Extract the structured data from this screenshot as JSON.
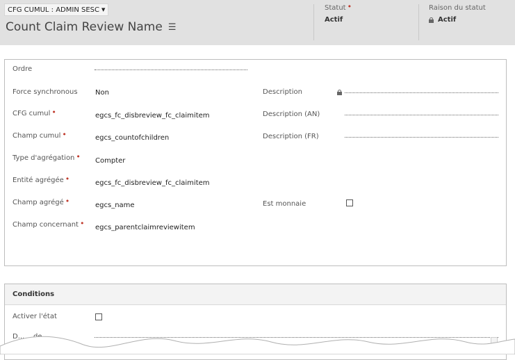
{
  "header": {
    "entity_name": "CFG CUMUL : ADMIN SESC",
    "record_title": "Count Claim Review Name",
    "status_label": "Statut",
    "status_value": "Actif",
    "status_reason_label": "Raison du statut",
    "status_reason_value": "Actif"
  },
  "general": {
    "order_label": "Ordre",
    "order_value": "",
    "force_sync_label": "Force synchronous",
    "force_sync_value": "Non",
    "rollup_cfg_label": "CFG cumul",
    "rollup_cfg_value": "egcs_fc_disbreview_fc_claimitem",
    "rollup_field_label": "Champ cumul",
    "rollup_field_value": "egcs_countofchildren",
    "aggregation_type_label": "Type d'agrégation",
    "aggregation_type_value": "Compter",
    "aggregated_entity_label": "Entité agrégée",
    "aggregated_entity_value": "egcs_fc_disbreview_fc_claimitem",
    "aggregated_field_label": "Champ agrégé",
    "aggregated_field_value": "egcs_name",
    "regarding_field_label": "Champ concernant",
    "regarding_field_value": "egcs_parentclaimreviewitem",
    "description_label": "Description",
    "description_en_label": "Description (AN)",
    "description_fr_label": "Description (FR)",
    "is_money_label": "Est monnaie"
  },
  "conditions": {
    "title": "Conditions",
    "enable_state_label": "Activer l'état",
    "partial_label": "D... ...de"
  },
  "colors": {
    "header_bg": "#e1e1e1",
    "required": "#c0392b"
  }
}
